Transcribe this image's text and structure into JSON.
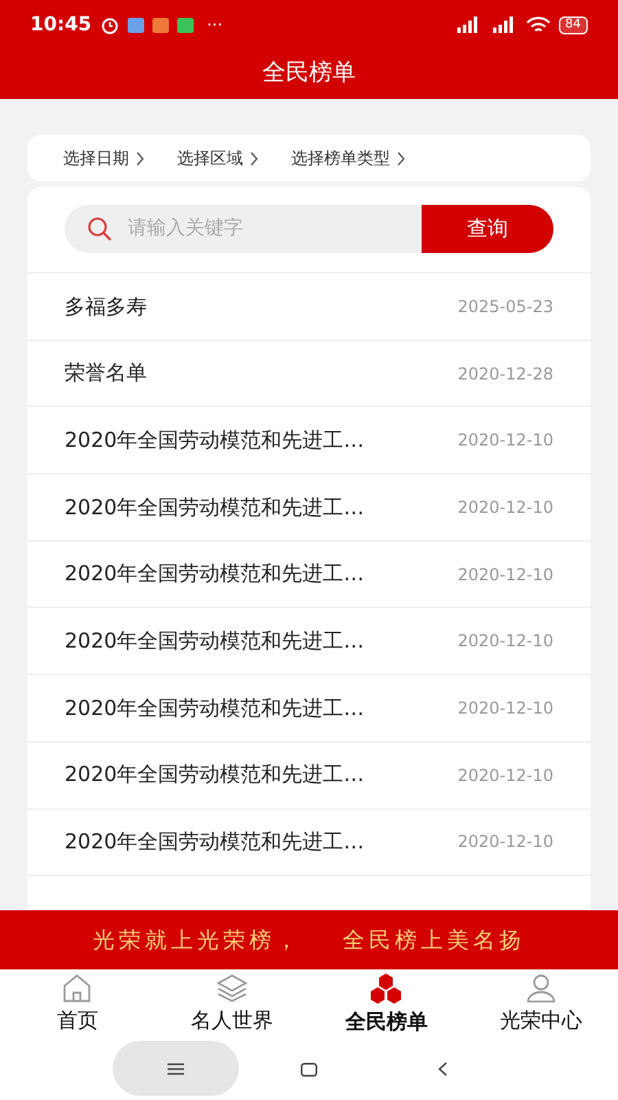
{
  "status_bar": {
    "time": "10:45",
    "more": "···",
    "battery": "84"
  },
  "header": {
    "title": "全民榜单"
  },
  "filters": [
    {
      "label": "选择日期"
    },
    {
      "label": "选择区域"
    },
    {
      "label": "选择榜单类型"
    }
  ],
  "search": {
    "placeholder": "请输入关键字",
    "button": "查询"
  },
  "rows": [
    {
      "title": "多福多寿",
      "date": "2025-05-23"
    },
    {
      "title": "荣誉名单",
      "date": "2020-12-28"
    },
    {
      "title": "2020年全国劳动模范和先进工…",
      "date": "2020-12-10"
    },
    {
      "title": "2020年全国劳动模范和先进工…",
      "date": "2020-12-10"
    },
    {
      "title": "2020年全国劳动模范和先进工…",
      "date": "2020-12-10"
    },
    {
      "title": "2020年全国劳动模范和先进工…",
      "date": "2020-12-10"
    },
    {
      "title": "2020年全国劳动模范和先进工…",
      "date": "2020-12-10"
    },
    {
      "title": "2020年全国劳动模范和先进工…",
      "date": "2020-12-10"
    },
    {
      "title": "2020年全国劳动模范和先进工…",
      "date": "2020-12-10"
    }
  ],
  "banner": {
    "left": "光荣就上光荣榜，",
    "right": "全民榜上美名扬"
  },
  "tabs": [
    {
      "label": "首页",
      "kind": "home",
      "selected": false
    },
    {
      "label": "名人世界",
      "kind": "layers",
      "selected": false
    },
    {
      "label": "全民榜单",
      "kind": "hexes",
      "selected": true
    },
    {
      "label": "光荣中心",
      "kind": "person",
      "selected": false
    }
  ]
}
